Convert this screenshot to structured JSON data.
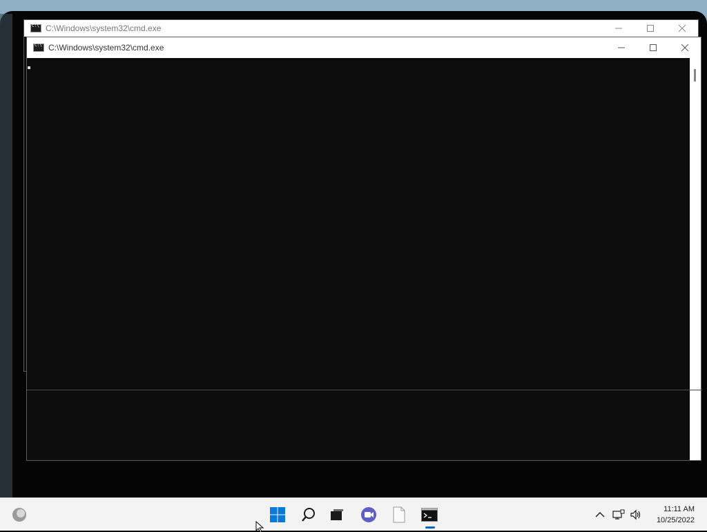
{
  "windows": [
    {
      "title": "C:\\Windows\\system32\\cmd.exe",
      "state": "inactive"
    },
    {
      "title": "C:\\Windows\\system32\\cmd.exe",
      "state": "active"
    }
  ],
  "window_controls": {
    "minimize": "minimize-icon",
    "maximize": "maximize-icon",
    "close": "close-icon"
  },
  "taskbar": {
    "items": [
      "weather-icon",
      "start-icon",
      "search-icon",
      "task-view-icon",
      "chat-icon",
      "notepad-icon",
      "cmd-icon"
    ],
    "active_item": "cmd-icon",
    "tray": [
      "chevron-up-icon",
      "network-icon",
      "volume-icon"
    ],
    "time": "11:11 AM",
    "date": "10/25/2022"
  },
  "colors": {
    "accent": "#0067c0",
    "console_bg": "#0c0c0c",
    "taskbar_bg": "#f3f3f3"
  }
}
